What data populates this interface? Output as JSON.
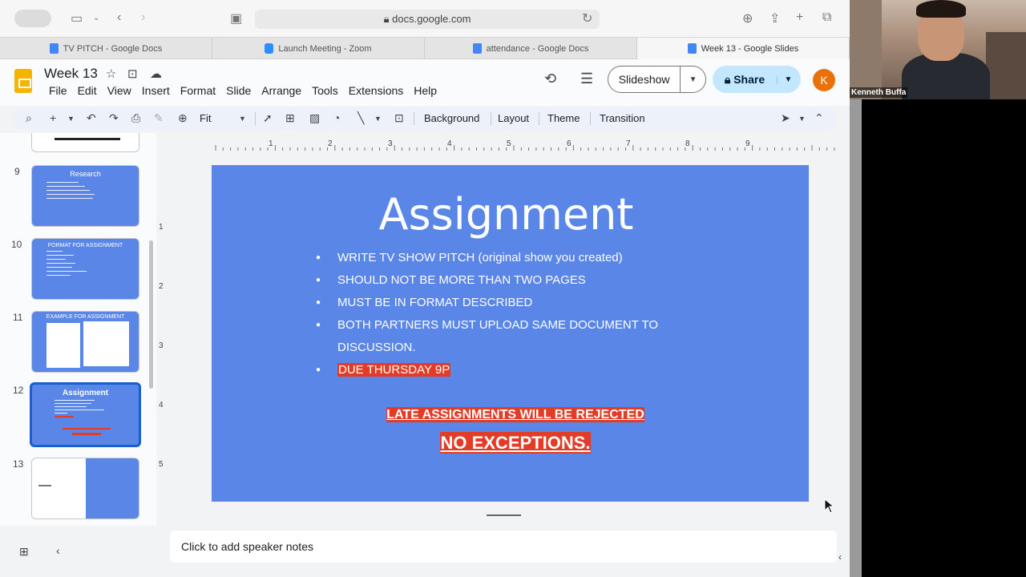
{
  "browser": {
    "url": "docs.google.com",
    "tabs": [
      {
        "label": "TV PITCH - Google Docs",
        "color": "#4285f4"
      },
      {
        "label": "Launch Meeting - Zoom",
        "color": "#2d8cff"
      },
      {
        "label": "attendance - Google Docs",
        "color": "#4285f4"
      },
      {
        "label": "Week 13 - Google Slides",
        "color": "#4285f4"
      }
    ]
  },
  "docs": {
    "title": "Week 13",
    "menu": [
      "File",
      "Edit",
      "View",
      "Insert",
      "Format",
      "Slide",
      "Arrange",
      "Tools",
      "Extensions",
      "Help"
    ],
    "slideshow_label": "Slideshow",
    "share_label": "Share",
    "avatar_letter": "K"
  },
  "toolbar": {
    "zoom": "Fit",
    "background": "Background",
    "layout": "Layout",
    "theme": "Theme",
    "transition": "Transition"
  },
  "ruler": {
    "horizontal": [
      "1",
      "2",
      "3",
      "4",
      "5",
      "6",
      "7",
      "8",
      "9"
    ],
    "vertical": [
      "1",
      "2",
      "3",
      "4",
      "5"
    ]
  },
  "filmstrip": {
    "slides": [
      {
        "number": "9",
        "title": "Research"
      },
      {
        "number": "10",
        "title": "FORMAT FOR ASSIGNMENT"
      },
      {
        "number": "11",
        "title": "EXAMPLE FOR ASSIGNMENT"
      },
      {
        "number": "12",
        "title": "Assignment"
      },
      {
        "number": "13",
        "title": ""
      }
    ]
  },
  "slide": {
    "title": "Assignment",
    "bullets": [
      "WRITE TV SHOW PITCH (original show you created)",
      "SHOULD NOT BE MORE THAN TWO PAGES",
      "MUST BE IN FORMAT DESCRIBED",
      "BOTH PARTNERS MUST UPLOAD SAME DOCUMENT TO DISCUSSION.",
      "DUE THURSDAY 9P"
    ],
    "late_notice": "LATE ASSIGNMENTS WILL BE REJECTED",
    "no_exceptions": "NO EXCEPTIONS.",
    "background_color": "#5a86e8",
    "highlight_color": "#e33b26"
  },
  "speaker_notes": "Click to add speaker notes",
  "webcam": {
    "name": "Kenneth Buffa"
  }
}
